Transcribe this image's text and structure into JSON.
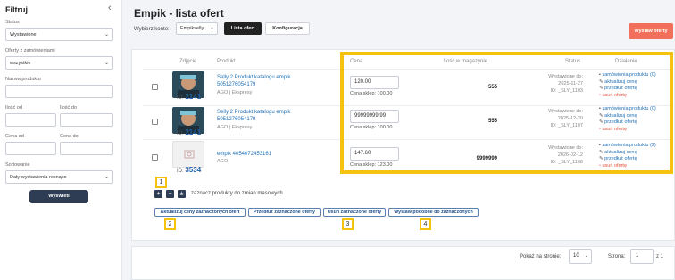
{
  "sidebar": {
    "title": "Filtruj",
    "collapse_icon": "chevron-left-icon",
    "status_label": "Status",
    "status_value": "Wystawione",
    "orders_label": "Oferty z zamówieniami",
    "orders_value": "wszystkie",
    "product_name_label": "Nazwa produktu",
    "qty_from_label": "Ilość od",
    "qty_to_label": "Ilość do",
    "price_from_label": "Cena od",
    "price_to_label": "Cena do",
    "sort_label": "Sortowanie",
    "sort_value": "Daty wystawienia rosnąco",
    "show_button": "Wyświetl"
  },
  "header": {
    "title": "Empik - lista ofert",
    "account_label": "Wybierz konto:",
    "account_value": "Empikselly",
    "list_button": "Lista ofert",
    "config_button": "Konfiguracja",
    "withdraw_button": "Wystaw oferty"
  },
  "table": {
    "columns": [
      "Zdjęcie",
      "Produkt",
      "Cena",
      "Ilość w magazynie",
      "Status",
      "Działanie"
    ],
    "rows": [
      {
        "id_label": "ID:",
        "id": "2141",
        "name": "Selly 2 Produkt katalogu empik 5051276054179",
        "meta": "AGO | Ekspresy",
        "price": "120.00",
        "shop_price": "Cena sklep: 100.00",
        "stock": "555",
        "status_line1": "Wystawione do:",
        "status_date": "2025-11-27",
        "status_id": "ID: _SLY_1103",
        "actions": [
          "zamówienia produktu (0)",
          "aktualizuj cenę",
          "przedłuż ofertę",
          "usuń ofertę"
        ]
      },
      {
        "id_label": "ID:",
        "id": "2141",
        "name": "Selly 2 Produkt katalogu empik 5051276054179",
        "meta": "AGO | Ekspresy",
        "price": "99999999.99",
        "shop_price": "Cena sklep: 100.00",
        "stock": "555",
        "status_line1": "Wystawione do:",
        "status_date": "2025-12-20",
        "status_id": "ID: _SLY_1107",
        "actions": [
          "zamówienia produktu (0)",
          "aktualizuj cenę",
          "przedłuż ofertę",
          "usuń ofertę"
        ]
      },
      {
        "id_label": "ID:",
        "id": "3534",
        "name": "empik 4054072453161",
        "meta": "AGO",
        "price": "147.60",
        "shop_price": "Cena sklep: 123.00",
        "stock": "9999999",
        "status_line1": "Wystawione do:",
        "status_date": "2026-02-12",
        "status_id": "ID: _SLY_1108",
        "actions": [
          "zamówienia produktu (2)",
          "aktualizuj cenę",
          "przedłuż ofertę",
          "usuń ofertę"
        ]
      }
    ]
  },
  "mass": {
    "label": "zaznacz produkty do zmian masowych",
    "plus": "+",
    "minus": "−",
    "invert": "±",
    "buttons": [
      "Aktualizuj ceny zaznaczonych ofert",
      "Przedłuż zaznaczone oferty",
      "Usuń zaznaczone oferty",
      "Wystaw podobne do zaznaczonych"
    ]
  },
  "markers": [
    "1",
    "2",
    "3",
    "4"
  ],
  "footer": {
    "per_page_label": "Pokaż na stronie:",
    "per_page_value": "10",
    "page_label": "Strona:",
    "page_value": "1",
    "page_of": "z 1"
  },
  "colors": {
    "accent_yellow": "#f5c20d",
    "link_blue": "#1f6fb5",
    "danger_red": "#e0533e",
    "withdraw_orange": "#f2705b",
    "dark_button": "#2f3d54"
  }
}
